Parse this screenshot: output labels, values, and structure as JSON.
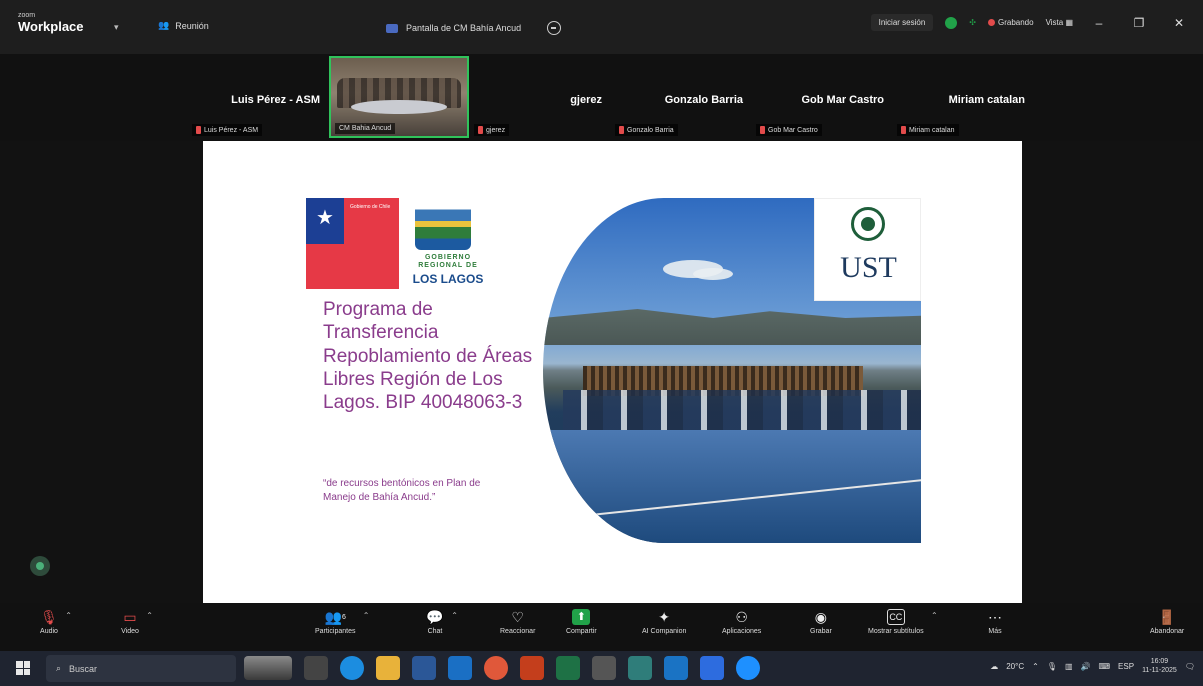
{
  "titlebar": {
    "brand_small": "zoom",
    "brand": "Workplace",
    "meeting_label": "Reunión",
    "share_tab_label": "Pantalla de CM Bahía Ancud",
    "signin_label": "Iniciar sesión",
    "recording_label": "Grabando",
    "view_label": "Vista"
  },
  "participants": [
    {
      "name": "Luis Pérez - ASM",
      "tag": "Luis Pérez - ASM"
    },
    {
      "name": "",
      "tag": "CM Bahia Ancud"
    },
    {
      "name": "gjerez",
      "tag": "gjerez"
    },
    {
      "name": "Gonzalo Barria",
      "tag": "Gonzalo Barria"
    },
    {
      "name": "Gob Mar Castro",
      "tag": "Gob Mar Castro"
    },
    {
      "name": "Miriam catalan",
      "tag": "Miriam catalan"
    }
  ],
  "slide": {
    "logo_gob_text": "Gobierno de Chile",
    "gore_line1": "GOBIERNO REGIONAL DE",
    "gore_line2": "LOS LAGOS",
    "title": "Programa de Transferencia Repoblamiento de Áreas Libres Región de Los Lagos. BIP 40048063-3",
    "quote": "“de recursos bentónicos en Plan de Manejo de Bahía Ancud.”",
    "ust_label": "UST"
  },
  "toolbar": {
    "audio": "Audio",
    "video": "Video",
    "participants": "Participantes",
    "participants_count": "6",
    "chat": "Chat",
    "reactions": "Reaccionar",
    "share": "Compartir",
    "ai": "AI Companion",
    "apps": "Aplicaciones",
    "record": "Grabar",
    "captions": "Mostrar subtítulos",
    "more": "Más",
    "leave": "Abandonar"
  },
  "taskbar": {
    "search_placeholder": "Buscar",
    "temperature": "20°C",
    "language": "ESP",
    "time": "16:09",
    "date": "11-11-2025"
  }
}
